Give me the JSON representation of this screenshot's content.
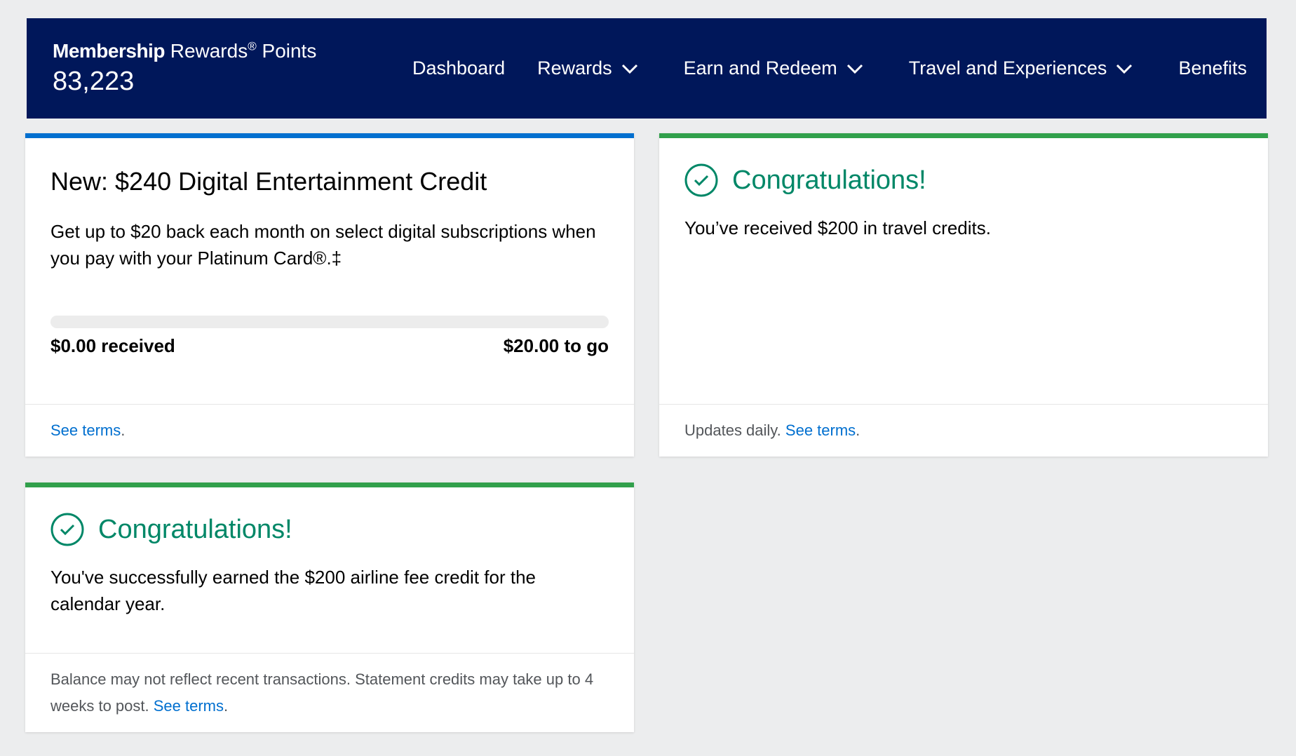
{
  "header": {
    "brand_bold": "Membership",
    "brand_rest": "Rewards",
    "brand_reg": "®",
    "brand_suffix": "Points",
    "points": "83,223",
    "menu": [
      {
        "label": "Dashboard",
        "has_dropdown": false
      },
      {
        "label": "Rewards",
        "has_dropdown": true
      },
      {
        "label": "Earn and Redeem",
        "has_dropdown": true
      },
      {
        "label": "Travel and Experiences",
        "has_dropdown": true
      },
      {
        "label": "Benefits",
        "has_dropdown": false
      }
    ]
  },
  "cards": {
    "digital": {
      "title": "New: $240 Digital Entertainment Credit",
      "text": "Get up to $20 back each month on select digital subscriptions when you pay with your Platinum Card®.‡",
      "progress_fraction": 0,
      "received": "$0.00 received",
      "to_go": "$20.00 to go",
      "footer_link": "See terms",
      "footer_period": "."
    },
    "travel": {
      "title": "Congratulations!",
      "text": "You’ve received $200 in travel credits.",
      "footer_text": "Updates daily. ",
      "footer_link": "See terms",
      "footer_period": "."
    },
    "airline": {
      "title": "Congratulations!",
      "text": "You've successfully earned the $200 airline fee credit for the calendar year.",
      "footer_text": "Balance may not reflect recent transactions. Statement credits may take up to 4 weeks to post. ",
      "footer_link": "See terms",
      "footer_period": "."
    }
  },
  "colors": {
    "nav_bg": "#00175a",
    "accent_blue": "#006fcf",
    "accent_green": "#31a04b",
    "congrats_green": "#008767",
    "page_bg": "#ecedee"
  },
  "icons": {
    "dropdown": "chevron-down-icon",
    "success": "check-circle-icon"
  }
}
